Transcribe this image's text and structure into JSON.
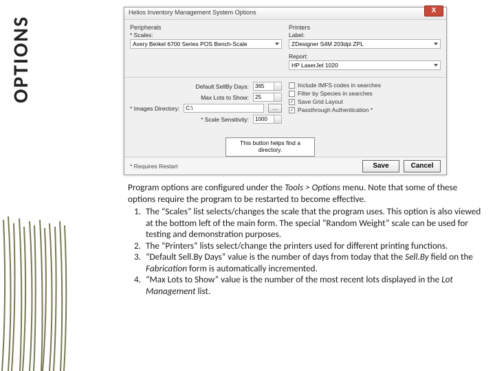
{
  "section_title": "OPTIONS",
  "dialog": {
    "title": "Helios Inventory Management System Options",
    "close": "X",
    "peripherals_label": "Peripherals",
    "scales_label": "* Scales:",
    "scales_value": "Avery Berkel 6700 Series POS Bench-Scale",
    "printers_label": "Printers",
    "label_printer_label": "Label:",
    "label_printer_value": "ZDesigner S4M 203dpi ZPL",
    "report_label": "Report:",
    "report_value": "HP LaserJet 1020",
    "default_sellby_label": "Default SellBy Days:",
    "default_sellby_value": "365",
    "max_lots_label": "Max Lots to Show:",
    "max_lots_value": "25",
    "images_dir_label": "* Images Directory:",
    "images_dir_value": "C:\\",
    "browse": "…",
    "scale_sens_label": "* Scale Sensitivity:",
    "scale_sens_value": "1000",
    "chk1": "Include IMFS codes in searches",
    "chk2": "Filter by Species in searches",
    "chk3": "Save Grid Layout",
    "chk4": "Passthrough Authentication *",
    "callout": "This button helps find a directory.",
    "requires_restart": "* Requires Restart",
    "save": "Save",
    "cancel": "Cancel"
  },
  "explain": {
    "intro_a": "Program options are configured under the ",
    "intro_em": "Tools > Options",
    "intro_b": " menu. Note that some of these options require the program to be restarted to become effective.",
    "item1": "The “Scales” list selects/changes the scale that the program uses. This option is also viewed at the bottom left of the main form. The special “Random Weight” scale can be used for testing and demonstration purposes.",
    "item2": "The “Printers” lists select/change the printers used for different printing functions.",
    "item3_a": "“Default Sell.By Days” value is the number of days from today that the ",
    "item3_em1": "Sell.By",
    "item3_b": " field on the ",
    "item3_em2": "Fabrication",
    "item3_c": " form is automatically incremented.",
    "item4_a": "“Max Lots to Show” value is the number of the most recent lots displayed in the ",
    "item4_em": "Lot Management",
    "item4_b": " list."
  }
}
